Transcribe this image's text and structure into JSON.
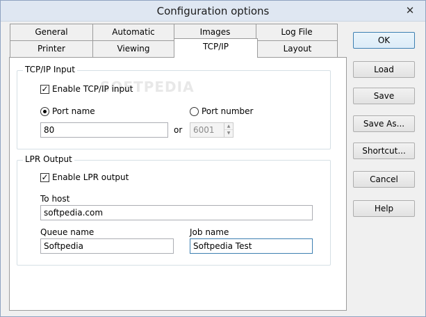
{
  "window": {
    "title": "Configuration options",
    "close_glyph": "✕"
  },
  "tabs": {
    "row1": [
      "General",
      "Automatic",
      "Images",
      "Log File"
    ],
    "row2": [
      "Printer",
      "Viewing",
      "TCP/IP",
      "Layout"
    ],
    "active": "TCP/IP"
  },
  "tcpip_input": {
    "title": "TCP/IP Input",
    "enable_label": "Enable TCP/IP input",
    "enable_checked": true,
    "port_name_label": "Port name",
    "port_number_label": "Port number",
    "selected": "Port name",
    "port_name_value": "80",
    "or_label": "or",
    "port_number_value": "6001"
  },
  "lpr_output": {
    "title": "LPR Output",
    "enable_label": "Enable LPR output",
    "enable_checked": true,
    "to_host_label": "To host",
    "to_host_value": "softpedia.com",
    "queue_name_label": "Queue name",
    "queue_name_value": "Softpedia",
    "job_name_label": "Job name",
    "job_name_value": "Softpedia Test"
  },
  "buttons": {
    "ok": "OK",
    "load": "Load",
    "save": "Save",
    "save_as": "Save As...",
    "shortcut": "Shortcut...",
    "cancel": "Cancel",
    "help": "Help"
  },
  "watermark_text": "SOFTPEDIA"
}
